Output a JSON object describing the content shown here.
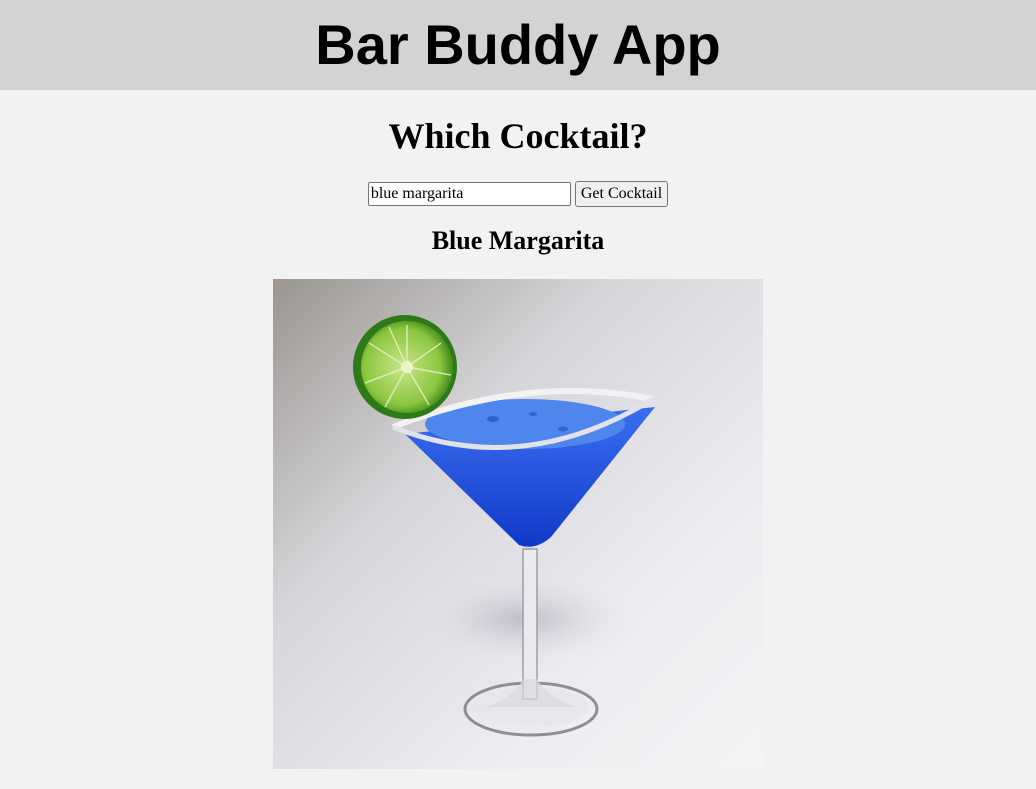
{
  "header": {
    "title": "Bar Buddy App"
  },
  "main": {
    "question": "Which Cocktail?",
    "search": {
      "value": "blue margarita",
      "button_label": "Get Cocktail"
    },
    "result": {
      "name": "Blue Margarita"
    }
  },
  "colors": {
    "header_bg": "#d3d3d3",
    "page_bg": "#f2f2f2",
    "drink_blue": "#1a4fd6",
    "lime_green": "#8cc63f"
  }
}
